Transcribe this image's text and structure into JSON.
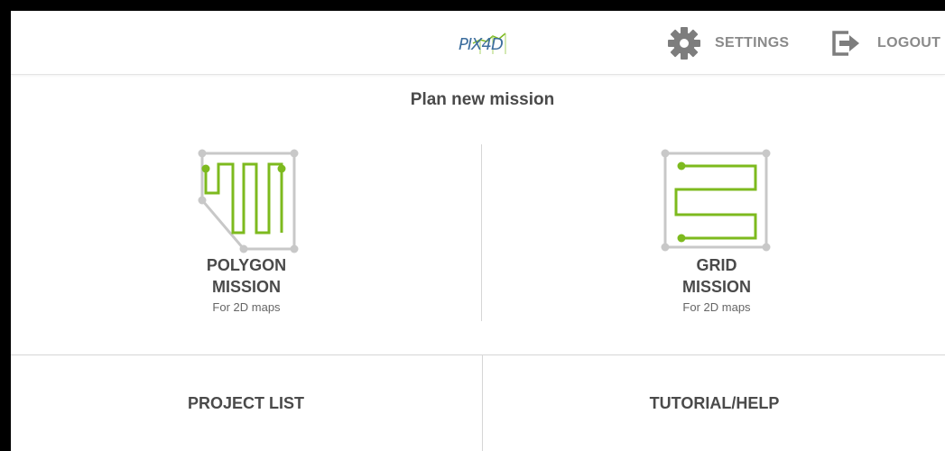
{
  "header": {
    "logo_text": "PIX4D",
    "settings_label": "SETTINGS",
    "logout_label": "LOGOUT"
  },
  "main": {
    "title": "Plan new mission",
    "missions": [
      {
        "title_line1": "POLYGON",
        "title_line2": "MISSION",
        "subtitle": "For 2D maps",
        "icon": "polygon-mission-icon"
      },
      {
        "title_line1": "GRID",
        "title_line2": "MISSION",
        "subtitle": "For 2D maps",
        "icon": "grid-mission-icon"
      }
    ]
  },
  "footer": {
    "project_list_label": "PROJECT LIST",
    "tutorial_label": "TUTORIAL/HELP"
  },
  "colors": {
    "accent_green": "#7dba1e",
    "logo_blue": "#3d6e9e",
    "icon_gray": "#7d7d7d",
    "text_dark": "#4a4a4a"
  }
}
